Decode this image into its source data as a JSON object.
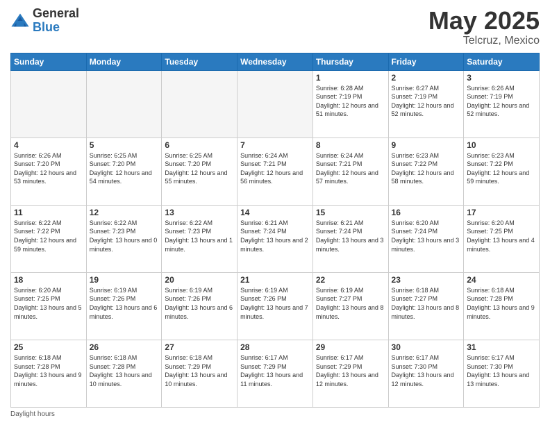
{
  "header": {
    "logo_general": "General",
    "logo_blue": "Blue",
    "month_title": "May 2025",
    "location": "Telcruz, Mexico"
  },
  "weekdays": [
    "Sunday",
    "Monday",
    "Tuesday",
    "Wednesday",
    "Thursday",
    "Friday",
    "Saturday"
  ],
  "footer": {
    "daylight_label": "Daylight hours"
  },
  "weeks": [
    [
      {
        "day": "",
        "empty": true
      },
      {
        "day": "",
        "empty": true
      },
      {
        "day": "",
        "empty": true
      },
      {
        "day": "",
        "empty": true
      },
      {
        "day": "1",
        "sunrise": "6:28 AM",
        "sunset": "7:19 PM",
        "daylight": "12 hours and 51 minutes."
      },
      {
        "day": "2",
        "sunrise": "6:27 AM",
        "sunset": "7:19 PM",
        "daylight": "12 hours and 52 minutes."
      },
      {
        "day": "3",
        "sunrise": "6:26 AM",
        "sunset": "7:19 PM",
        "daylight": "12 hours and 52 minutes."
      }
    ],
    [
      {
        "day": "4",
        "sunrise": "6:26 AM",
        "sunset": "7:20 PM",
        "daylight": "12 hours and 53 minutes."
      },
      {
        "day": "5",
        "sunrise": "6:25 AM",
        "sunset": "7:20 PM",
        "daylight": "12 hours and 54 minutes."
      },
      {
        "day": "6",
        "sunrise": "6:25 AM",
        "sunset": "7:20 PM",
        "daylight": "12 hours and 55 minutes."
      },
      {
        "day": "7",
        "sunrise": "6:24 AM",
        "sunset": "7:21 PM",
        "daylight": "12 hours and 56 minutes."
      },
      {
        "day": "8",
        "sunrise": "6:24 AM",
        "sunset": "7:21 PM",
        "daylight": "12 hours and 57 minutes."
      },
      {
        "day": "9",
        "sunrise": "6:23 AM",
        "sunset": "7:22 PM",
        "daylight": "12 hours and 58 minutes."
      },
      {
        "day": "10",
        "sunrise": "6:23 AM",
        "sunset": "7:22 PM",
        "daylight": "12 hours and 59 minutes."
      }
    ],
    [
      {
        "day": "11",
        "sunrise": "6:22 AM",
        "sunset": "7:22 PM",
        "daylight": "12 hours and 59 minutes."
      },
      {
        "day": "12",
        "sunrise": "6:22 AM",
        "sunset": "7:23 PM",
        "daylight": "13 hours and 0 minutes."
      },
      {
        "day": "13",
        "sunrise": "6:22 AM",
        "sunset": "7:23 PM",
        "daylight": "13 hours and 1 minute."
      },
      {
        "day": "14",
        "sunrise": "6:21 AM",
        "sunset": "7:24 PM",
        "daylight": "13 hours and 2 minutes."
      },
      {
        "day": "15",
        "sunrise": "6:21 AM",
        "sunset": "7:24 PM",
        "daylight": "13 hours and 3 minutes."
      },
      {
        "day": "16",
        "sunrise": "6:20 AM",
        "sunset": "7:24 PM",
        "daylight": "13 hours and 3 minutes."
      },
      {
        "day": "17",
        "sunrise": "6:20 AM",
        "sunset": "7:25 PM",
        "daylight": "13 hours and 4 minutes."
      }
    ],
    [
      {
        "day": "18",
        "sunrise": "6:20 AM",
        "sunset": "7:25 PM",
        "daylight": "13 hours and 5 minutes."
      },
      {
        "day": "19",
        "sunrise": "6:19 AM",
        "sunset": "7:26 PM",
        "daylight": "13 hours and 6 minutes."
      },
      {
        "day": "20",
        "sunrise": "6:19 AM",
        "sunset": "7:26 PM",
        "daylight": "13 hours and 6 minutes."
      },
      {
        "day": "21",
        "sunrise": "6:19 AM",
        "sunset": "7:26 PM",
        "daylight": "13 hours and 7 minutes."
      },
      {
        "day": "22",
        "sunrise": "6:19 AM",
        "sunset": "7:27 PM",
        "daylight": "13 hours and 8 minutes."
      },
      {
        "day": "23",
        "sunrise": "6:18 AM",
        "sunset": "7:27 PM",
        "daylight": "13 hours and 8 minutes."
      },
      {
        "day": "24",
        "sunrise": "6:18 AM",
        "sunset": "7:28 PM",
        "daylight": "13 hours and 9 minutes."
      }
    ],
    [
      {
        "day": "25",
        "sunrise": "6:18 AM",
        "sunset": "7:28 PM",
        "daylight": "13 hours and 9 minutes."
      },
      {
        "day": "26",
        "sunrise": "6:18 AM",
        "sunset": "7:28 PM",
        "daylight": "13 hours and 10 minutes."
      },
      {
        "day": "27",
        "sunrise": "6:18 AM",
        "sunset": "7:29 PM",
        "daylight": "13 hours and 10 minutes."
      },
      {
        "day": "28",
        "sunrise": "6:17 AM",
        "sunset": "7:29 PM",
        "daylight": "13 hours and 11 minutes."
      },
      {
        "day": "29",
        "sunrise": "6:17 AM",
        "sunset": "7:29 PM",
        "daylight": "13 hours and 12 minutes."
      },
      {
        "day": "30",
        "sunrise": "6:17 AM",
        "sunset": "7:30 PM",
        "daylight": "13 hours and 12 minutes."
      },
      {
        "day": "31",
        "sunrise": "6:17 AM",
        "sunset": "7:30 PM",
        "daylight": "13 hours and 13 minutes."
      }
    ]
  ]
}
